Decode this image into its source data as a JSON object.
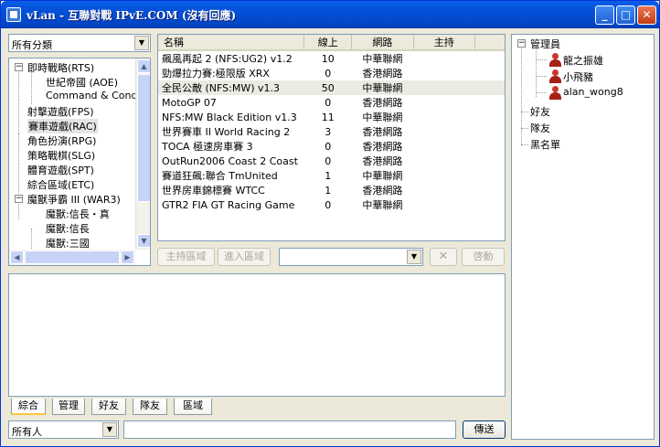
{
  "window": {
    "title": "vLan - 互聯對戰 IPvE.COM (沒有回應)"
  },
  "category_select": {
    "value": "所有分類"
  },
  "tree": {
    "items": [
      {
        "label": "即時戰略(RTS)",
        "expander": "−"
      },
      {
        "label": "世紀帝國 (AOE)"
      },
      {
        "label": "Command & Conque"
      },
      {
        "label": "射擊遊戲(FPS)"
      },
      {
        "label": "賽車遊戲(RAC)"
      },
      {
        "label": "角色扮演(RPG)"
      },
      {
        "label": "策略戰棋(SLG)"
      },
      {
        "label": "體育遊戲(SPT)"
      },
      {
        "label": "綜合區域(ETC)"
      },
      {
        "label": "魔獸爭霸 III (WAR3)",
        "expander": "−"
      },
      {
        "label": "魔獸:信長・真"
      },
      {
        "label": "魔獸:信長"
      },
      {
        "label": "魔獸:三國"
      }
    ]
  },
  "room_list": {
    "columns": [
      "名稱",
      "線上",
      "網路",
      "主持"
    ],
    "rows": [
      {
        "name": "飆風再起 2 (NFS:UG2) v1.2",
        "online": "10",
        "network": "中華聯網",
        "host": ""
      },
      {
        "name": "勁爆拉力賽:極限版 XRX",
        "online": "0",
        "network": "香港網路",
        "host": ""
      },
      {
        "name": "全民公敵 (NFS:MW) v1.3",
        "online": "50",
        "network": "中華聯網",
        "host": ""
      },
      {
        "name": "MotoGP 07",
        "online": "0",
        "network": "香港網路",
        "host": ""
      },
      {
        "name": "NFS:MW Black Edition v1.3",
        "online": "11",
        "network": "中華聯網",
        "host": ""
      },
      {
        "name": "世界賽車 II  World Racing 2",
        "online": "3",
        "network": "香港網路",
        "host": ""
      },
      {
        "name": "TOCA 極速房車賽 3",
        "online": "0",
        "network": "香港網路",
        "host": ""
      },
      {
        "name": "OutRun2006 Coast 2 Coast",
        "online": "0",
        "network": "香港網路",
        "host": ""
      },
      {
        "name": "賽道狂飆:聯合 TmUnited",
        "online": "1",
        "network": "中華聯網",
        "host": ""
      },
      {
        "name": "世界房車錦標賽 WTCC",
        "online": "1",
        "network": "香港網路",
        "host": ""
      },
      {
        "name": "GTR2 FIA GT Racing Game",
        "online": "0",
        "network": "中華聯網",
        "host": ""
      }
    ]
  },
  "buttons": {
    "host_area": "主持區域",
    "enter_area": "進入區域",
    "cancel": "✕",
    "start": "啓動",
    "send": "傳送"
  },
  "tabs": [
    "綜合",
    "管理",
    "好友",
    "隊友",
    "區域"
  ],
  "recipient_select": {
    "value": "所有人"
  },
  "user_tree": {
    "admins_label": "管理員",
    "admins": [
      "龍之振雄",
      "小飛豬",
      "alan_wong8"
    ],
    "friends_label": "好友",
    "teammates_label": "隊友",
    "blacklist_label": "黑名單"
  },
  "icons": {
    "minimize": "minimize-icon",
    "maximize": "maximize-icon",
    "close": "close-icon",
    "user": "user-icon"
  },
  "colors": {
    "title_bar": "#0450d8",
    "close_button": "#c23d14",
    "active_tab_accent": "#ffc83c"
  }
}
